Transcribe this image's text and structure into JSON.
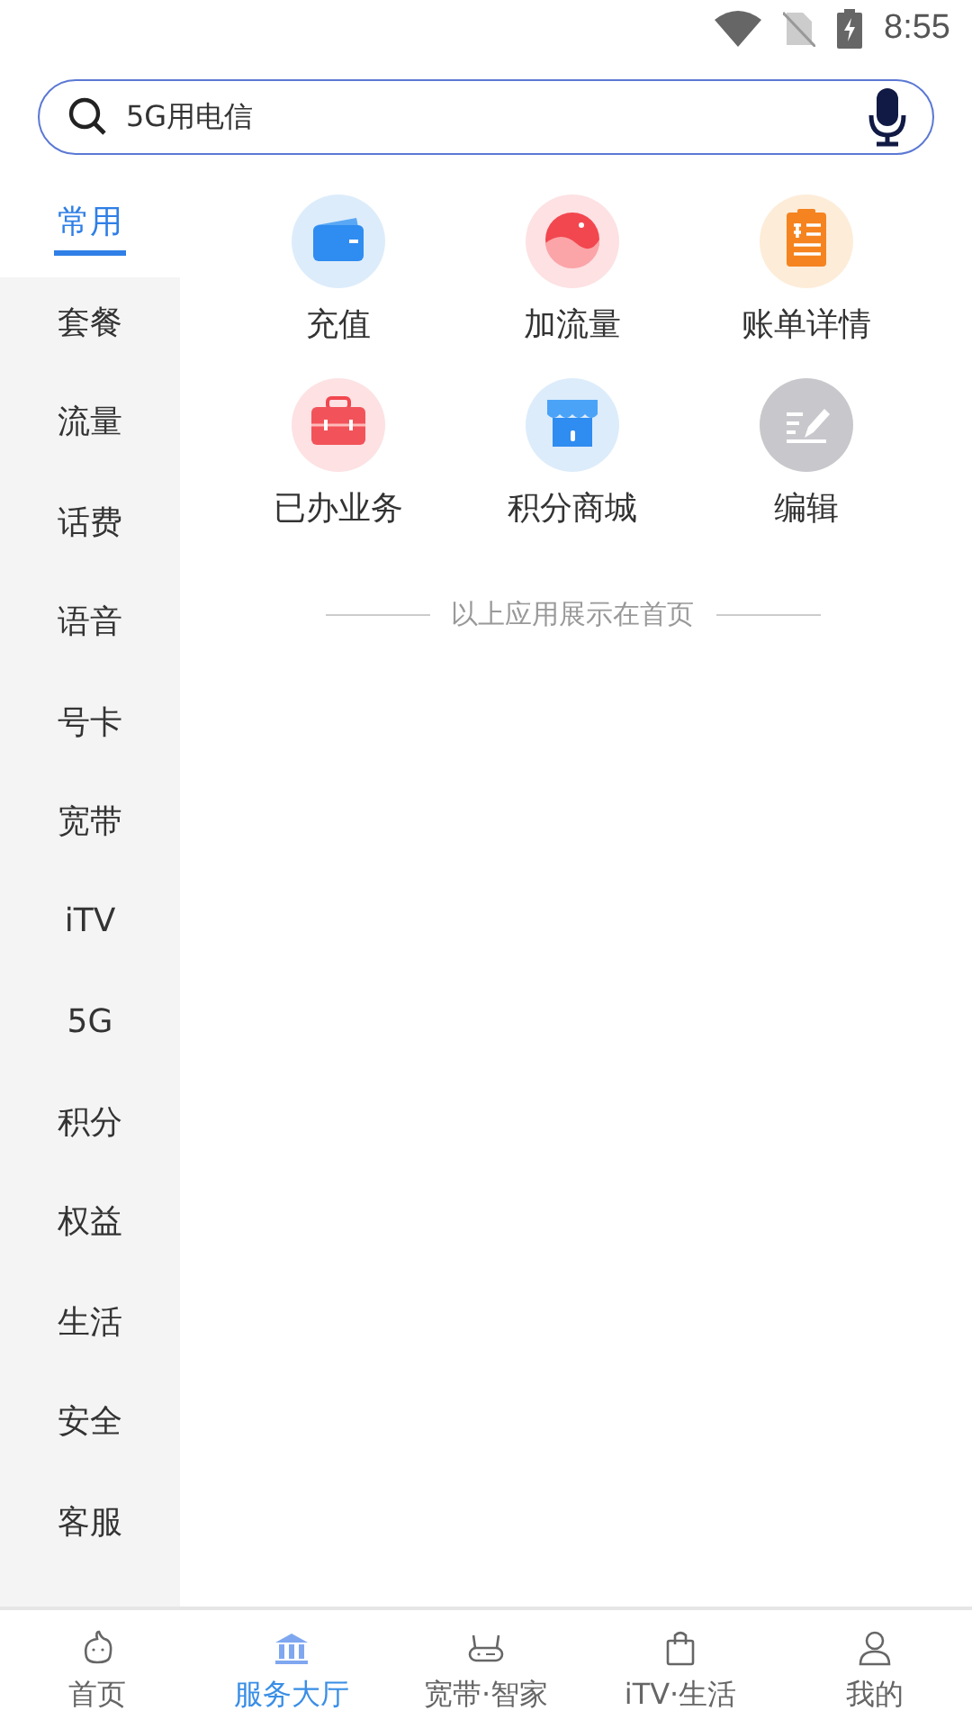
{
  "status_bar": {
    "time": "8:55"
  },
  "search": {
    "value": "5G用电信"
  },
  "sidebar": {
    "items": [
      {
        "label": "常用",
        "selected": true
      },
      {
        "label": "套餐",
        "selected": false
      },
      {
        "label": "流量",
        "selected": false
      },
      {
        "label": "话费",
        "selected": false
      },
      {
        "label": "语音",
        "selected": false
      },
      {
        "label": "号卡",
        "selected": false
      },
      {
        "label": "宽带",
        "selected": false
      },
      {
        "label": "iTV",
        "selected": false
      },
      {
        "label": "5G",
        "selected": false
      },
      {
        "label": "积分",
        "selected": false
      },
      {
        "label": "权益",
        "selected": false
      },
      {
        "label": "生活",
        "selected": false
      },
      {
        "label": "安全",
        "selected": false
      },
      {
        "label": "客服",
        "selected": false
      }
    ]
  },
  "apps": [
    {
      "label": "充值"
    },
    {
      "label": "加流量"
    },
    {
      "label": "账单详情"
    },
    {
      "label": "已办业务"
    },
    {
      "label": "积分商城"
    },
    {
      "label": "编辑"
    }
  ],
  "divider_note": "以上应用展示在首页",
  "bottom_nav": [
    {
      "label": "首页",
      "selected": false
    },
    {
      "label": "服务大厅",
      "selected": true
    },
    {
      "label": "宽带·智家",
      "selected": false
    },
    {
      "label": "iTV·生活",
      "selected": false
    },
    {
      "label": "我的",
      "selected": false
    }
  ]
}
